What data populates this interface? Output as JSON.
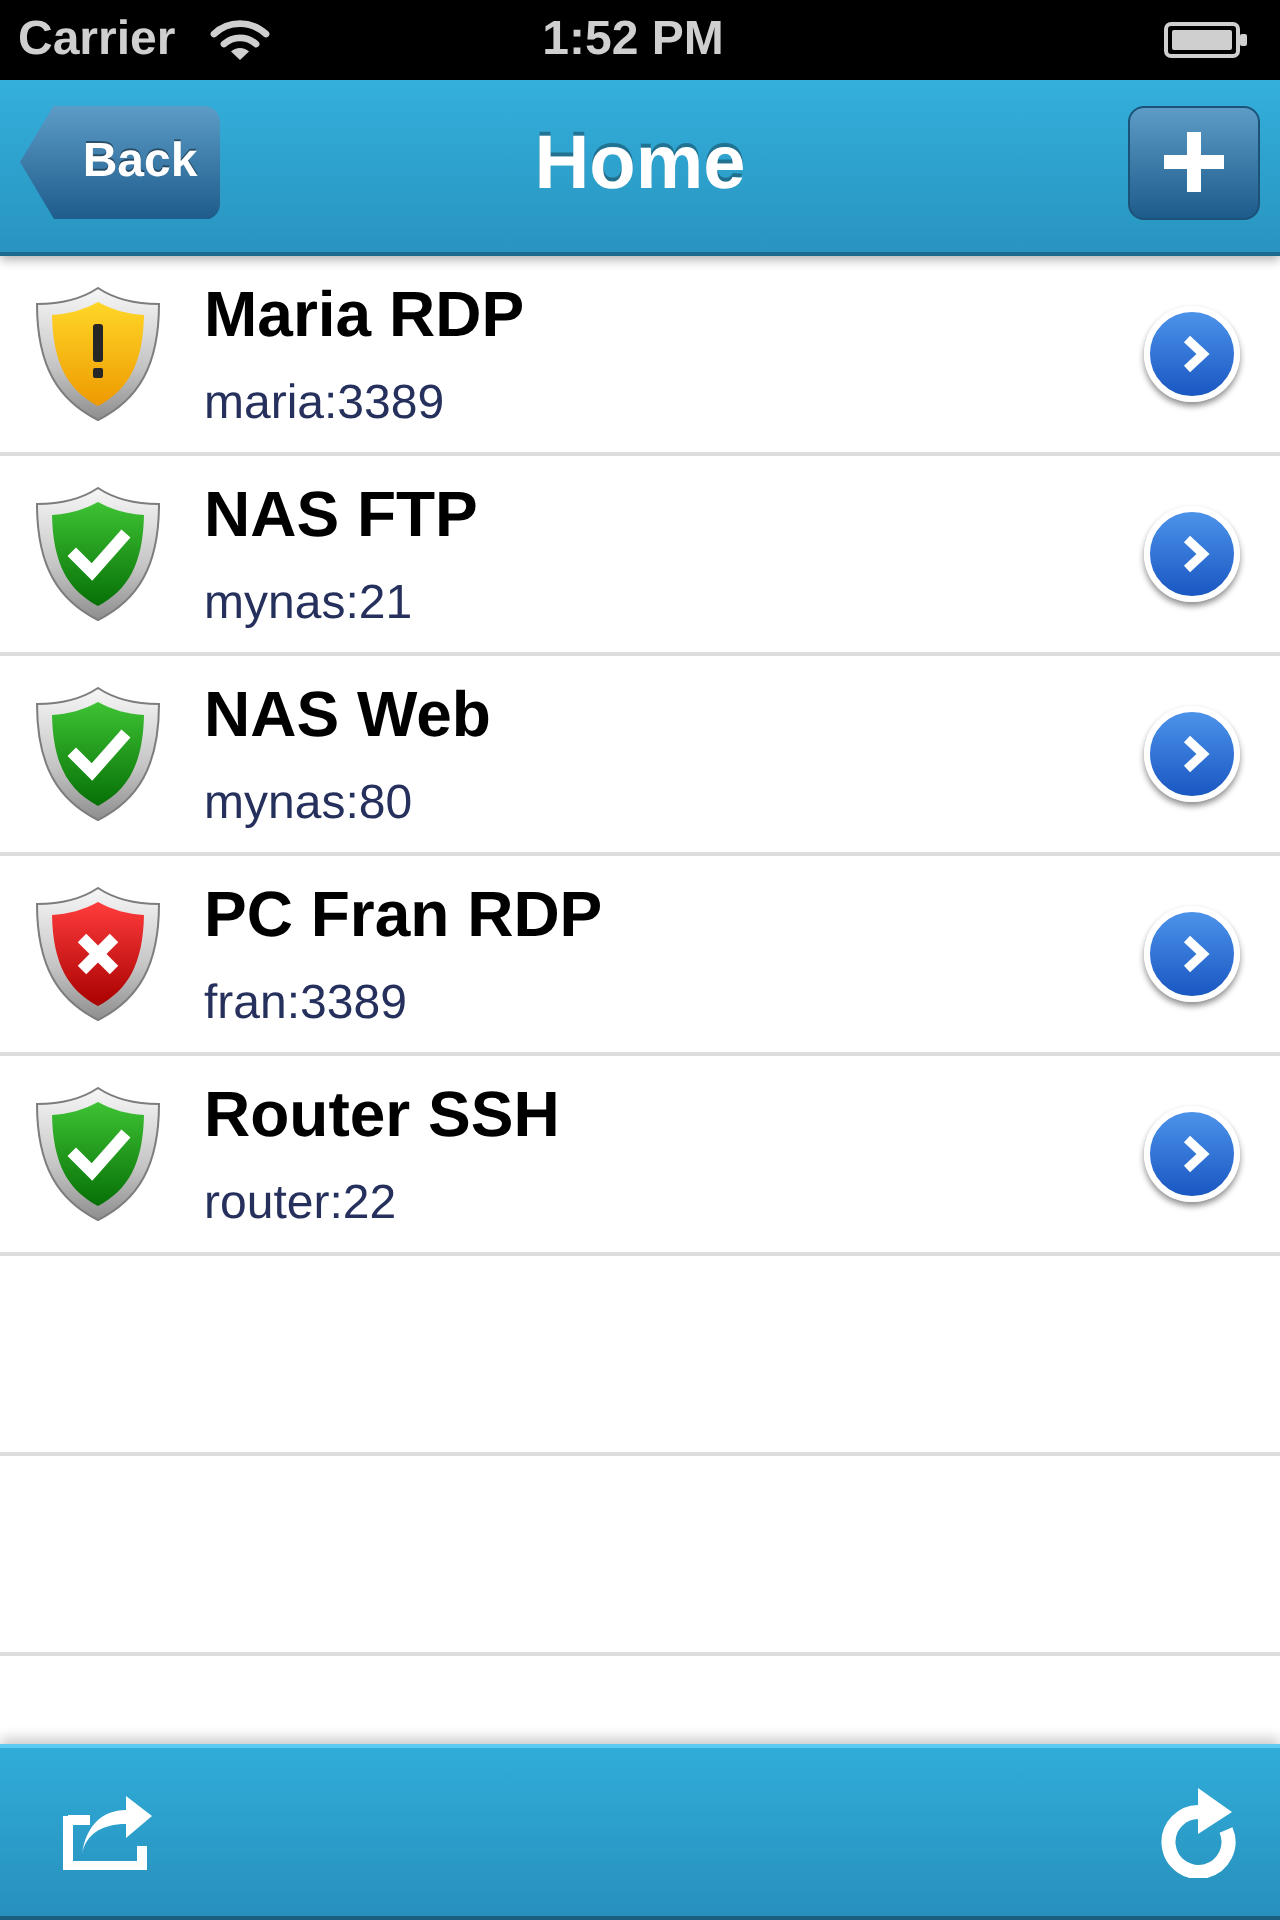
{
  "status_bar": {
    "carrier": "Carrier",
    "time": "1:52 PM"
  },
  "nav_bar": {
    "back_button": "Back",
    "title": "Home"
  },
  "connections": [
    {
      "name": "Maria RDP",
      "address": "maria:3389",
      "kind": "warning"
    },
    {
      "name": "NAS FTP",
      "address": "mynas:21",
      "kind": "ok"
    },
    {
      "name": "NAS Web",
      "address": "mynas:80",
      "kind": "ok"
    },
    {
      "name": "PC Fran RDP",
      "address": "fran:3389",
      "kind": "error"
    },
    {
      "name": "Router SSH",
      "address": "router:22",
      "kind": "ok"
    }
  ]
}
